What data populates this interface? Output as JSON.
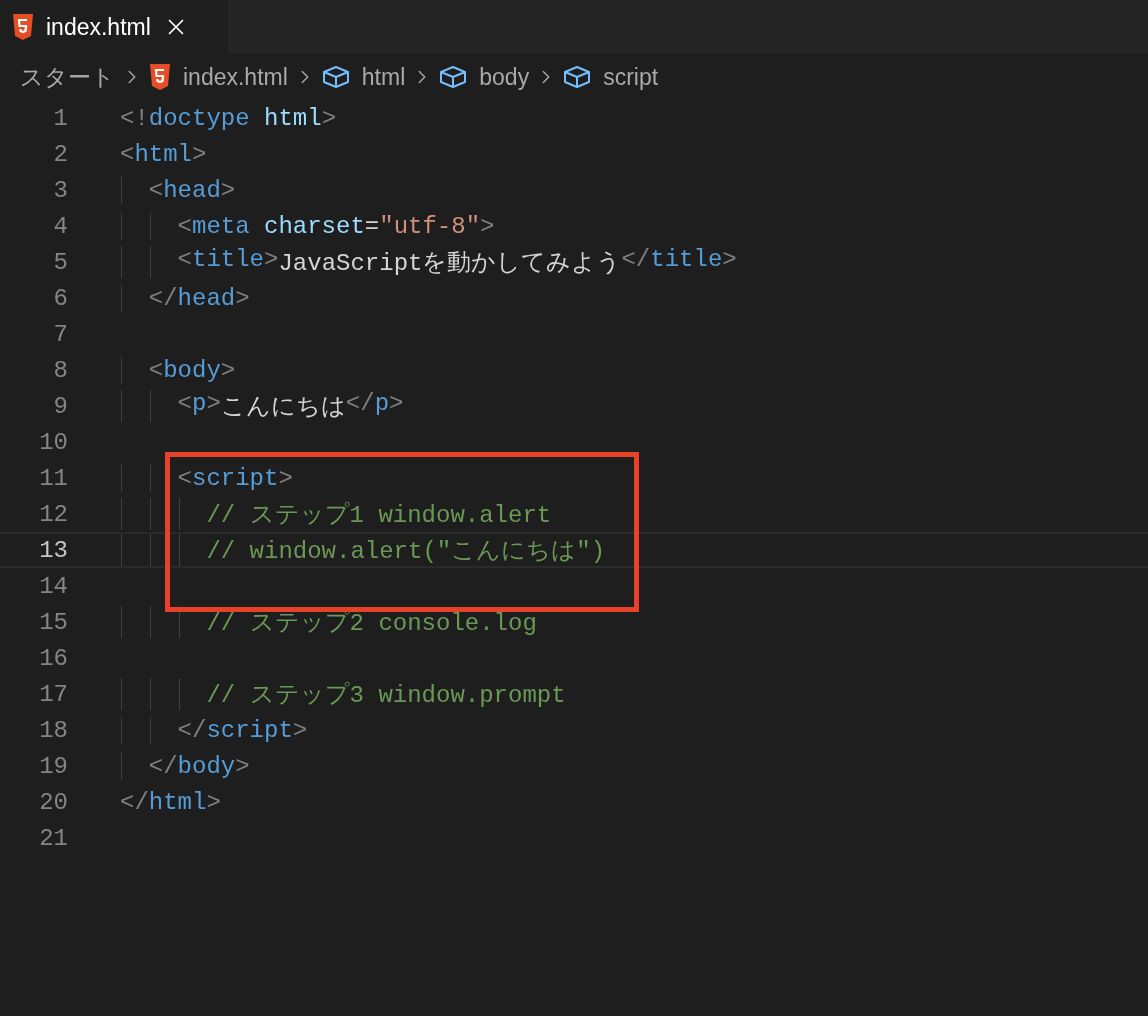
{
  "tabs": [
    {
      "label": "index.html",
      "selected": true
    }
  ],
  "breadcrumbs": [
    {
      "kind": "folder",
      "label": "スタート"
    },
    {
      "kind": "file",
      "label": "index.html"
    },
    {
      "kind": "symbol",
      "label": "html"
    },
    {
      "kind": "symbol",
      "label": "body"
    },
    {
      "kind": "symbol",
      "label": "script"
    }
  ],
  "lines": [
    {
      "number": "1",
      "current": false,
      "boxed": false,
      "tokens": [
        {
          "kind": "punct",
          "text": "<!"
        },
        {
          "kind": "tag",
          "text": "doctype"
        },
        {
          "kind": "attr",
          "text": " html"
        },
        {
          "kind": "punct",
          "text": ">"
        }
      ]
    },
    {
      "number": "2",
      "current": false,
      "boxed": false,
      "tokens": [
        {
          "kind": "punct",
          "text": "<"
        },
        {
          "kind": "tag",
          "text": "html"
        },
        {
          "kind": "punct",
          "text": ">"
        }
      ],
      "children": [
        {
          "number": "3",
          "current": false,
          "boxed": false,
          "tokens": [
            {
              "kind": "punct",
              "text": "<"
            },
            {
              "kind": "tag",
              "text": "head"
            },
            {
              "kind": "punct",
              "text": ">"
            }
          ],
          "children": [
            {
              "number": "4",
              "current": false,
              "boxed": false,
              "tokens": [
                {
                  "kind": "punct",
                  "text": "<"
                },
                {
                  "kind": "tag",
                  "text": "meta"
                },
                {
                  "kind": "attr",
                  "text": " charset"
                },
                {
                  "kind": "text",
                  "text": "="
                },
                {
                  "kind": "string",
                  "text": "\"utf-8\""
                },
                {
                  "kind": "punct",
                  "text": ">"
                }
              ]
            },
            {
              "number": "5",
              "current": false,
              "boxed": false,
              "tokens": [
                {
                  "kind": "punct",
                  "text": "<"
                },
                {
                  "kind": "tag",
                  "text": "title"
                },
                {
                  "kind": "punct",
                  "text": ">"
                },
                {
                  "kind": "text",
                  "text": "JavaScriptを動かしてみよう"
                },
                {
                  "kind": "punct",
                  "text": "</"
                },
                {
                  "kind": "tag",
                  "text": "title"
                },
                {
                  "kind": "punct",
                  "text": ">"
                }
              ]
            }
          ]
        },
        {
          "number": "6",
          "current": false,
          "boxed": false,
          "tokens": [
            {
              "kind": "punct",
              "text": "</"
            },
            {
              "kind": "tag",
              "text": "head"
            },
            {
              "kind": "punct",
              "text": ">"
            }
          ]
        },
        {
          "number": "7",
          "current": false,
          "boxed": false
        },
        {
          "number": "8",
          "current": false,
          "boxed": false,
          "tokens": [
            {
              "kind": "punct",
              "text": "<"
            },
            {
              "kind": "tag",
              "text": "body"
            },
            {
              "kind": "punct",
              "text": ">"
            }
          ],
          "children": [
            {
              "number": "9",
              "current": false,
              "boxed": false,
              "tokens": [
                {
                  "kind": "punct",
                  "text": "<"
                },
                {
                  "kind": "tag",
                  "text": "p"
                },
                {
                  "kind": "punct",
                  "text": ">"
                },
                {
                  "kind": "text",
                  "text": "こんにちは"
                },
                {
                  "kind": "punct",
                  "text": "</"
                },
                {
                  "kind": "tag",
                  "text": "p"
                },
                {
                  "kind": "punct",
                  "text": ">"
                }
              ]
            },
            {
              "number": "10",
              "current": false,
              "boxed": false
            },
            {
              "number": "11",
              "current": false,
              "boxed": true,
              "tokens": [
                {
                  "kind": "punct",
                  "text": "<"
                },
                {
                  "kind": "tag",
                  "text": "script"
                },
                {
                  "kind": "punct",
                  "text": ">"
                }
              ],
              "children": [
                {
                  "number": "12",
                  "current": false,
                  "boxed": true,
                  "tokens": [
                    {
                      "kind": "comment",
                      "text": "// ステップ1 window.alert"
                    }
                  ]
                },
                {
                  "number": "13",
                  "current": true,
                  "boxed": true,
                  "tokens": [
                    {
                      "kind": "comment",
                      "text": "// window.alert(\"こんにちは\")"
                    }
                  ]
                },
                {
                  "number": "14",
                  "current": false,
                  "boxed": true
                },
                {
                  "number": "15",
                  "current": false,
                  "boxed": false,
                  "tokens": [
                    {
                      "kind": "comment",
                      "text": "// ステップ2 console.log"
                    }
                  ]
                },
                {
                  "number": "16",
                  "current": false,
                  "boxed": false
                },
                {
                  "number": "17",
                  "current": false,
                  "boxed": false,
                  "tokens": [
                    {
                      "kind": "comment",
                      "text": "// ステップ3 window.prompt"
                    }
                  ]
                }
              ]
            },
            {
              "number": "18",
              "current": false,
              "boxed": false,
              "tokens": [
                {
                  "kind": "punct",
                  "text": "</"
                },
                {
                  "kind": "tag",
                  "text": "script"
                },
                {
                  "kind": "punct",
                  "text": ">"
                }
              ]
            }
          ]
        },
        {
          "number": "19",
          "current": false,
          "boxed": false,
          "tokens": [
            {
              "kind": "punct",
              "text": "</"
            },
            {
              "kind": "tag",
              "text": "body"
            },
            {
              "kind": "punct",
              "text": ">"
            }
          ]
        }
      ]
    },
    {
      "number": "20",
      "current": false,
      "boxed": false,
      "tokens": [
        {
          "kind": "punct",
          "text": "</"
        },
        {
          "kind": "tag",
          "text": "html"
        },
        {
          "kind": "punct",
          "text": ">"
        }
      ]
    },
    {
      "number": "21",
      "current": false,
      "boxed": false
    }
  ]
}
